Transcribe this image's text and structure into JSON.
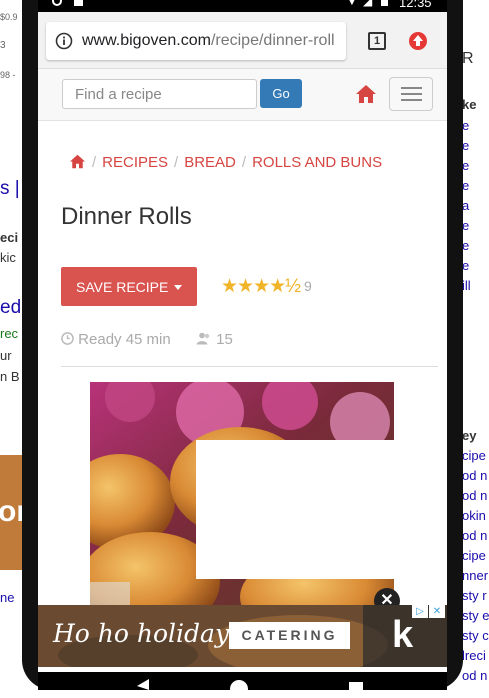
{
  "status_bar": {
    "time": "12:35"
  },
  "browser": {
    "url_domain": "www.bigoven.com",
    "url_path": "/recipe/dinner-roll",
    "tab_count": "1"
  },
  "site_nav": {
    "search_placeholder": "Find a recipe",
    "go_label": "Go"
  },
  "breadcrumbs": [
    "RECIPES",
    "BREAD",
    "ROLLS AND BUNS"
  ],
  "recipe": {
    "title": "Dinner Rolls",
    "save_label": "SAVE RECIPE",
    "rating": 4.5,
    "rating_stars": "★★★★½",
    "rating_count": "9",
    "ready": "Ready 45 min",
    "servings": "15"
  },
  "ad_banner": {
    "script_text": "Ho ho holiday",
    "button_text": "CATERING",
    "logo": "k"
  },
  "background_page": {
    "left_fragments": [
      "$0.9",
      "3",
      "98 -",
      "s |",
      "eci",
      "kic",
      "ed",
      "rec",
      "ur",
      "n B",
      "or",
      "ne"
    ],
    "right_fragments": [
      "R",
      "ke",
      "e",
      "e",
      "e",
      "e",
      "a",
      "e",
      "e",
      "e",
      "ill",
      "ey",
      "cipe",
      "od n",
      "od n",
      "okin",
      "od n",
      "cipe",
      "nner",
      "sty r",
      "sty e",
      "sty c",
      "lreci",
      "od n"
    ]
  },
  "colors": {
    "accent_red": "#d64541",
    "button_red": "#d9534f",
    "go_blue": "#337ab7",
    "star_gold": "#f0b429"
  }
}
